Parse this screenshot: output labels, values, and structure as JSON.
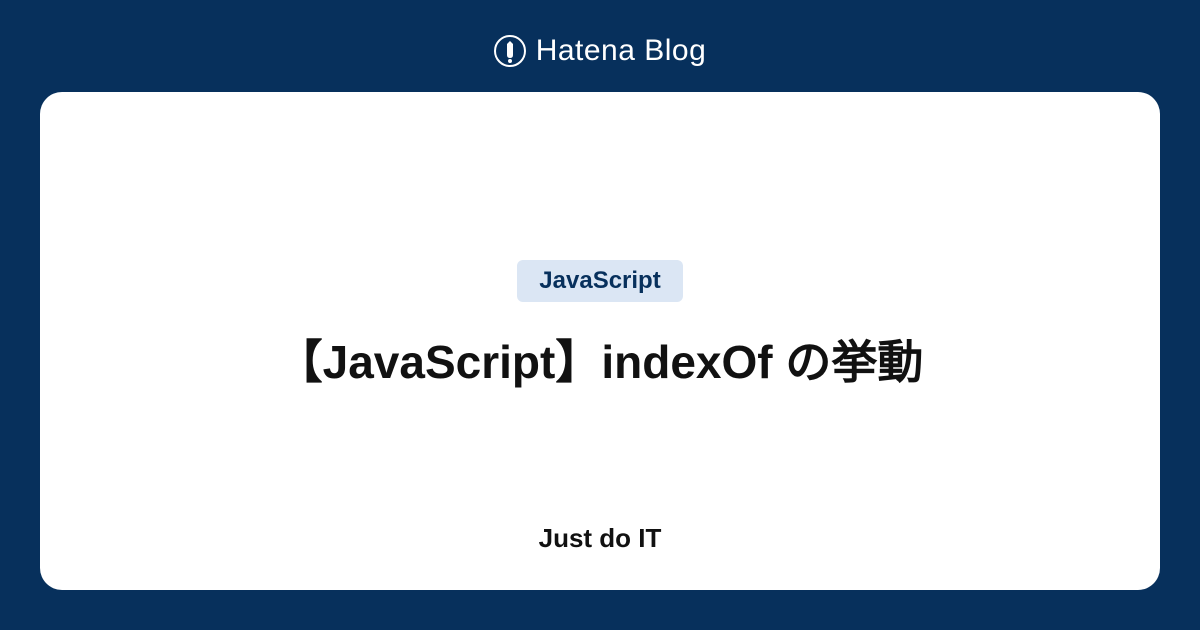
{
  "header": {
    "brand": "Hatena Blog"
  },
  "card": {
    "tag": "JavaScript",
    "title": "【JavaScript】indexOf の挙動",
    "blog_name": "Just do IT"
  }
}
